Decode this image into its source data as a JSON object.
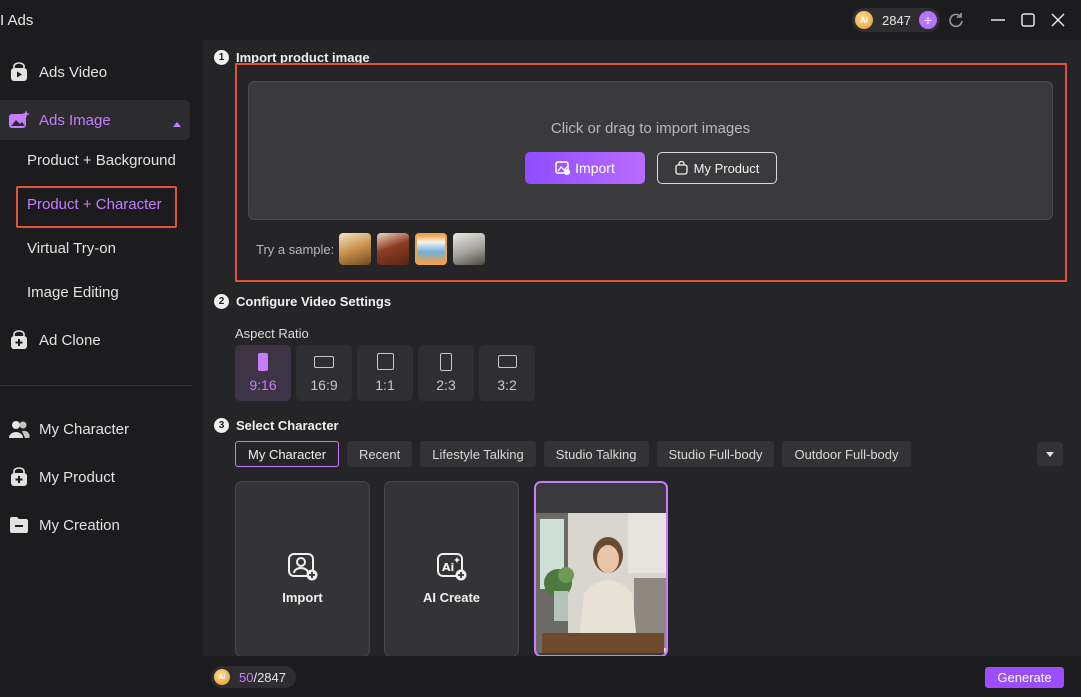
{
  "app": {
    "title": "I Ads"
  },
  "credits": {
    "balance": "2847",
    "coin_label": "AI"
  },
  "sidebar": {
    "ads_video": "Ads Video",
    "ads_image": "Ads Image",
    "sub_items": [
      "Product + Background",
      "Product + Character",
      "Virtual Try-on",
      "Image Editing"
    ],
    "ad_clone": "Ad Clone",
    "my_character": "My Character",
    "my_product": "My Product",
    "my_creation": "My Creation"
  },
  "steps": {
    "s1": {
      "num": "1",
      "title": "Import product image"
    },
    "s2": {
      "num": "2",
      "title": "Configure Video Settings"
    },
    "s3": {
      "num": "3",
      "title": "Select Character"
    }
  },
  "import": {
    "hint": "Click or drag to import images",
    "import_label": "Import",
    "my_product_label": "My Product",
    "sample_label": "Try a sample:"
  },
  "aspect_ratio": {
    "label": "Aspect Ratio",
    "options": [
      "9:16",
      "16:9",
      "1:1",
      "2:3",
      "3:2"
    ],
    "selected": "9:16"
  },
  "character_tabs": [
    "My Character",
    "Recent",
    "Lifestyle Talking",
    "Studio Talking",
    "Studio Full-body",
    "Outdoor Full-body"
  ],
  "character_cards": {
    "import_label": "Import",
    "ai_create_label": "AI Create"
  },
  "footer": {
    "cost_used": "50",
    "cost_total": "/2847",
    "generate_label": "Generate"
  },
  "colors": {
    "accent": "#c77dff",
    "highlight_border": "#e0523a",
    "button_gradient_start": "#8f4dff"
  }
}
